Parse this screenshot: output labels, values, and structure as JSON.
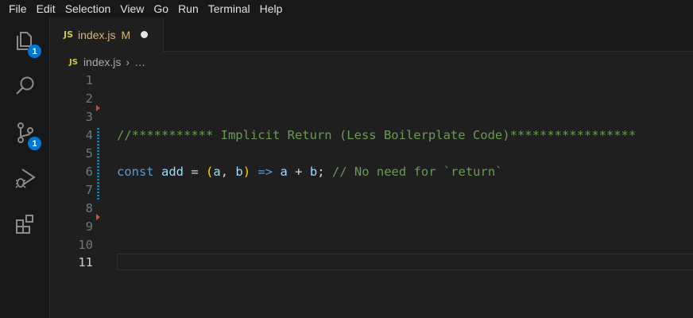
{
  "menu": [
    "File",
    "Edit",
    "Selection",
    "View",
    "Go",
    "Run",
    "Terminal",
    "Help"
  ],
  "activity": {
    "explorer_badge": "1",
    "source_control_badge": "1"
  },
  "tab": {
    "icon": "JS",
    "filename": "index.js",
    "status": "M"
  },
  "breadcrumb": {
    "icon": "JS",
    "file": "index.js",
    "separator": "›",
    "ellipsis": "…"
  },
  "editor": {
    "line_numbers": [
      "1",
      "2",
      "3",
      "4",
      "5",
      "6",
      "7",
      "8",
      "9",
      "10",
      "11"
    ],
    "active_line": "11",
    "line4": {
      "comment": "//*********** Implicit Return (Less Boilerplate Code)*****************"
    },
    "line6": {
      "kw": "const",
      "name": "add",
      "eq": "=",
      "lparen": "(",
      "a": "a",
      "comma": ",",
      "b": "b",
      "rparen": ")",
      "arrow": "=>",
      "body_a": "a",
      "plus": "+",
      "body_b": "b",
      "semi": ";",
      "comment": "// No need for `return`"
    }
  },
  "colors": {
    "background": "#1f1f1f",
    "badge": "#0078d4",
    "modified_gutter": "#1b81a8",
    "deleted_gutter": "#c74e39"
  }
}
